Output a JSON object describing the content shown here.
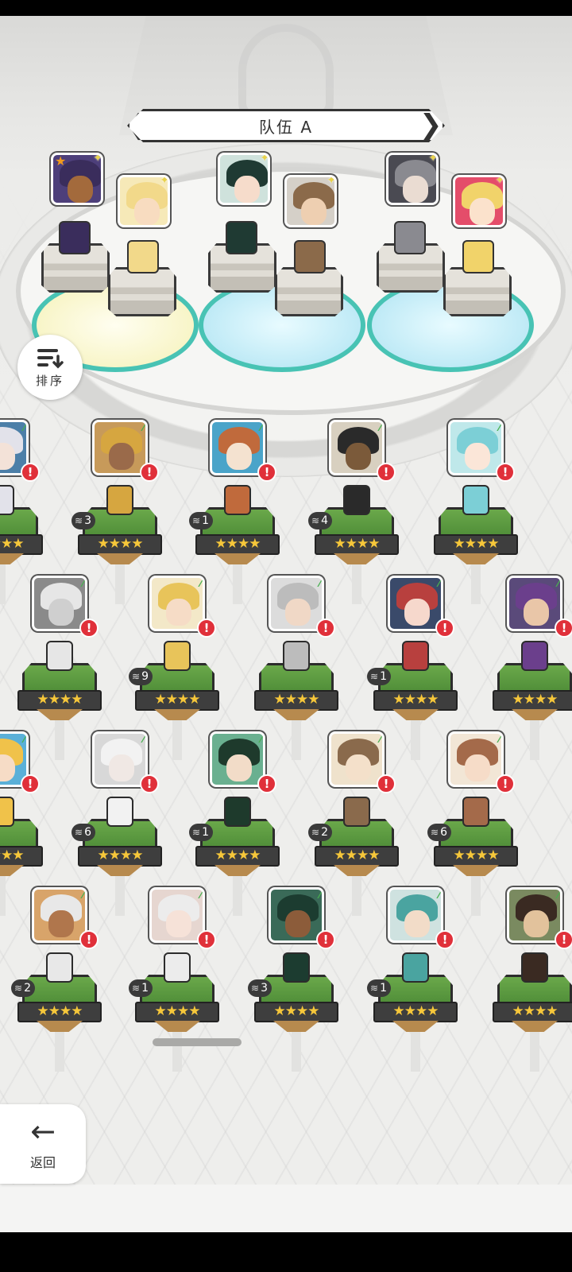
{
  "team": {
    "title": "队伍 A",
    "slots": [
      {
        "id": "slot-1",
        "pad": "yellow",
        "back_portrait": {
          "hair": "#3a2d5c",
          "face": "#a36a3c",
          "bg": "#4d3f7a",
          "star": true
        },
        "front_portrait": {
          "hair": "#f2d98a",
          "face": "#f8dcc0",
          "bg": "#f6e9b8"
        }
      },
      {
        "id": "slot-2",
        "pad": "blue",
        "back_portrait": {
          "hair": "#1f3a33",
          "face": "#f6dccb",
          "bg": "#cfe2dc"
        },
        "front_portrait": {
          "hair": "#8b6a4a",
          "face": "#eecfb1",
          "bg": "#d5d0c8"
        }
      },
      {
        "id": "slot-3",
        "pad": "blue",
        "back_portrait": {
          "hair": "#8a8a90",
          "face": "#eadcd2",
          "bg": "#4a4a52"
        },
        "front_portrait": {
          "hair": "#f1d36a",
          "face": "#fbe2cc",
          "bg": "#e44d6a"
        }
      }
    ]
  },
  "sort": {
    "label": "排序"
  },
  "back": {
    "label": "返回"
  },
  "stars": "★★★★",
  "heroes": [
    {
      "row": 0,
      "col": 0,
      "hair": "#e2e2ea",
      "face": "#f3e2d8",
      "bg": "#4c7fa8",
      "level": "",
      "stars": "★★★★"
    },
    {
      "row": 0,
      "col": 1,
      "hair": "#d6a640",
      "face": "#9a6a4a",
      "bg": "#c79a5a",
      "level": "3",
      "stars": "★★★★"
    },
    {
      "row": 0,
      "col": 2,
      "hair": "#c06a3c",
      "face": "#f4e2d0",
      "bg": "#4aa4c9",
      "level": "1",
      "stars": "★★★★"
    },
    {
      "row": 0,
      "col": 3,
      "hair": "#2a2a2a",
      "face": "#7b5a3a",
      "bg": "#d8d0c0",
      "level": "4",
      "stars": "★★★★"
    },
    {
      "row": 0,
      "col": 4,
      "hair": "#7ccfd6",
      "face": "#fbe6d8",
      "bg": "#bfe8ea",
      "level": "",
      "stars": "★★★★"
    },
    {
      "row": 1,
      "col": 0,
      "hair": "#e6e6e6",
      "face": "#cfcfcf",
      "bg": "#8a8a8a",
      "level": "",
      "stars": "★★★★"
    },
    {
      "row": 1,
      "col": 1,
      "hair": "#e8c45a",
      "face": "#f6dcc6",
      "bg": "#f3e8c8",
      "level": "9",
      "stars": "★★★★"
    },
    {
      "row": 1,
      "col": 2,
      "hair": "#bcbcbc",
      "face": "#f0d8c6",
      "bg": "#dcdcdc",
      "level": "",
      "stars": "★★★★"
    },
    {
      "row": 1,
      "col": 3,
      "hair": "#b8403e",
      "face": "#f6d8cc",
      "bg": "#3a4a6a",
      "level": "1",
      "stars": "★★★★"
    },
    {
      "row": 1,
      "col": 4,
      "hair": "#6b3f8c",
      "face": "#e9c6a8",
      "bg": "#5a4a7a",
      "level": "",
      "stars": "★★★★"
    },
    {
      "row": 2,
      "col": 0,
      "hair": "#f0c24a",
      "face": "#f6dcc6",
      "bg": "#5ab0d8",
      "level": "",
      "stars": "★★★★"
    },
    {
      "row": 2,
      "col": 1,
      "hair": "#f2f2f2",
      "face": "#f0e8e4",
      "bg": "#d8d8d8",
      "level": "6",
      "stars": "★★★★"
    },
    {
      "row": 2,
      "col": 2,
      "hair": "#1e3a2c",
      "face": "#f2dcc8",
      "bg": "#6ab090",
      "level": "1",
      "stars": "★★★★"
    },
    {
      "row": 2,
      "col": 3,
      "hair": "#8a6a4c",
      "face": "#f4e0ca",
      "bg": "#efe2cc",
      "level": "2",
      "stars": "★★★★"
    },
    {
      "row": 2,
      "col": 4,
      "hair": "#a46a4a",
      "face": "#f6dcc8",
      "bg": "#f2e6d6",
      "level": "6",
      "stars": "★★★★"
    },
    {
      "row": 3,
      "col": 0,
      "hair": "#e8e8e8",
      "face": "#b0764c",
      "bg": "#d8a46a",
      "level": "2",
      "stars": "★★★★"
    },
    {
      "row": 3,
      "col": 1,
      "hair": "#ececec",
      "face": "#f6e2d8",
      "bg": "#e6d6d0",
      "level": "1",
      "stars": "★★★★"
    },
    {
      "row": 3,
      "col": 2,
      "hair": "#1c3c30",
      "face": "#8c5c3a",
      "bg": "#3a6a58",
      "level": "3",
      "stars": "★★★★"
    },
    {
      "row": 3,
      "col": 3,
      "hair": "#4aa4a0",
      "face": "#f2dcc8",
      "bg": "#cfe2e0",
      "level": "1",
      "stars": "★★★★"
    },
    {
      "row": 3,
      "col": 4,
      "hair": "#3a2a22",
      "face": "#e2c29c",
      "bg": "#7a8a60",
      "level": "",
      "stars": "★★★★"
    }
  ]
}
